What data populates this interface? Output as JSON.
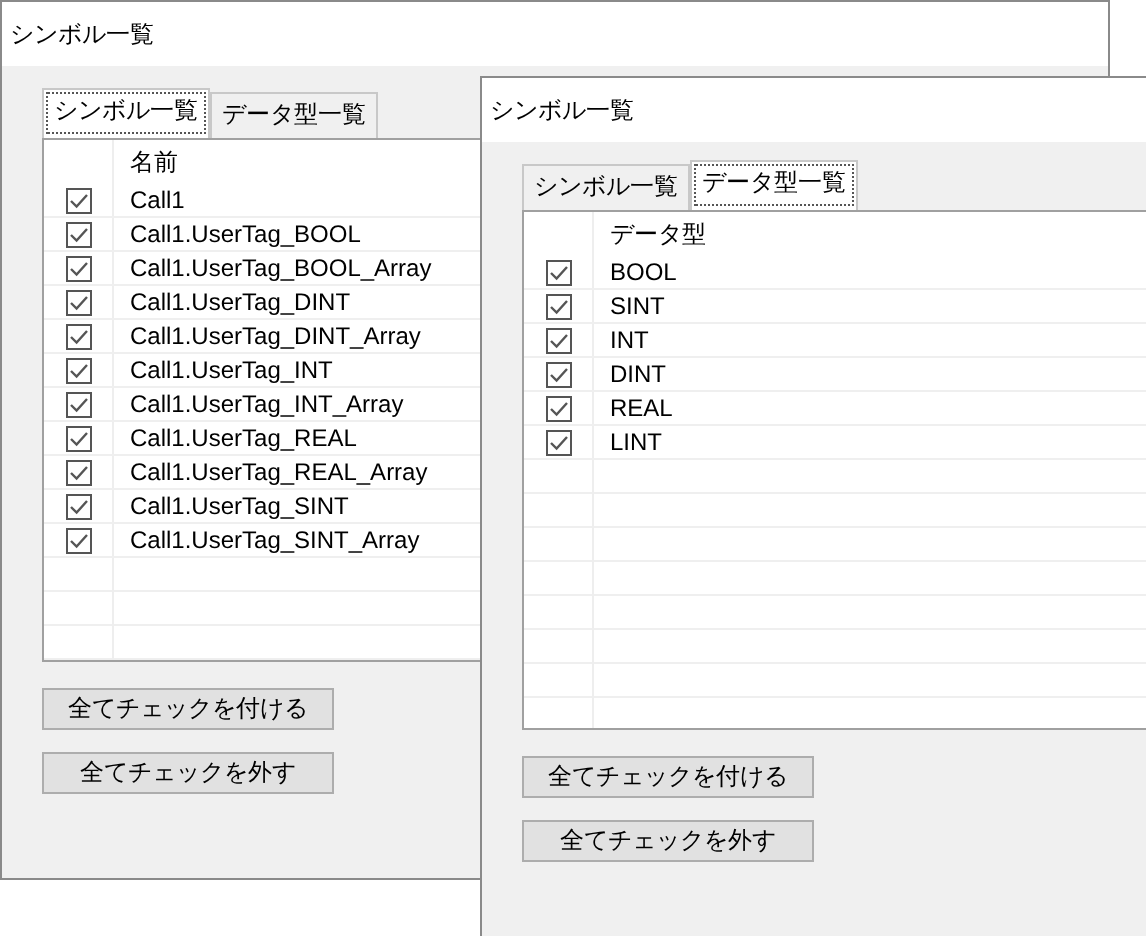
{
  "windows": [
    {
      "title": "シンボル一覧",
      "tabs": [
        {
          "label": "シンボル一覧",
          "selected": true
        },
        {
          "label": "データ型一覧",
          "selected": false
        }
      ],
      "column": "名前",
      "rows": [
        {
          "checked": true,
          "name": "Call1"
        },
        {
          "checked": true,
          "name": "Call1.UserTag_BOOL"
        },
        {
          "checked": true,
          "name": "Call1.UserTag_BOOL_Array"
        },
        {
          "checked": true,
          "name": "Call1.UserTag_DINT"
        },
        {
          "checked": true,
          "name": "Call1.UserTag_DINT_Array"
        },
        {
          "checked": true,
          "name": "Call1.UserTag_INT"
        },
        {
          "checked": true,
          "name": "Call1.UserTag_INT_Array"
        },
        {
          "checked": true,
          "name": "Call1.UserTag_REAL"
        },
        {
          "checked": true,
          "name": "Call1.UserTag_REAL_Array"
        },
        {
          "checked": true,
          "name": "Call1.UserTag_SINT"
        },
        {
          "checked": true,
          "name": "Call1.UserTag_SINT_Array"
        }
      ],
      "buttons": [
        "全てチェックを付ける",
        "全てチェックを外す"
      ]
    },
    {
      "title": "シンボル一覧",
      "tabs": [
        {
          "label": "シンボル一覧",
          "selected": false
        },
        {
          "label": "データ型一覧",
          "selected": true
        }
      ],
      "column": "データ型",
      "rows": [
        {
          "checked": true,
          "name": "BOOL"
        },
        {
          "checked": true,
          "name": "SINT"
        },
        {
          "checked": true,
          "name": "INT"
        },
        {
          "checked": true,
          "name": "DINT"
        },
        {
          "checked": true,
          "name": "REAL"
        },
        {
          "checked": true,
          "name": "LINT"
        }
      ],
      "buttons": [
        "全てチェックを付ける",
        "全てチェックを外す"
      ]
    }
  ]
}
